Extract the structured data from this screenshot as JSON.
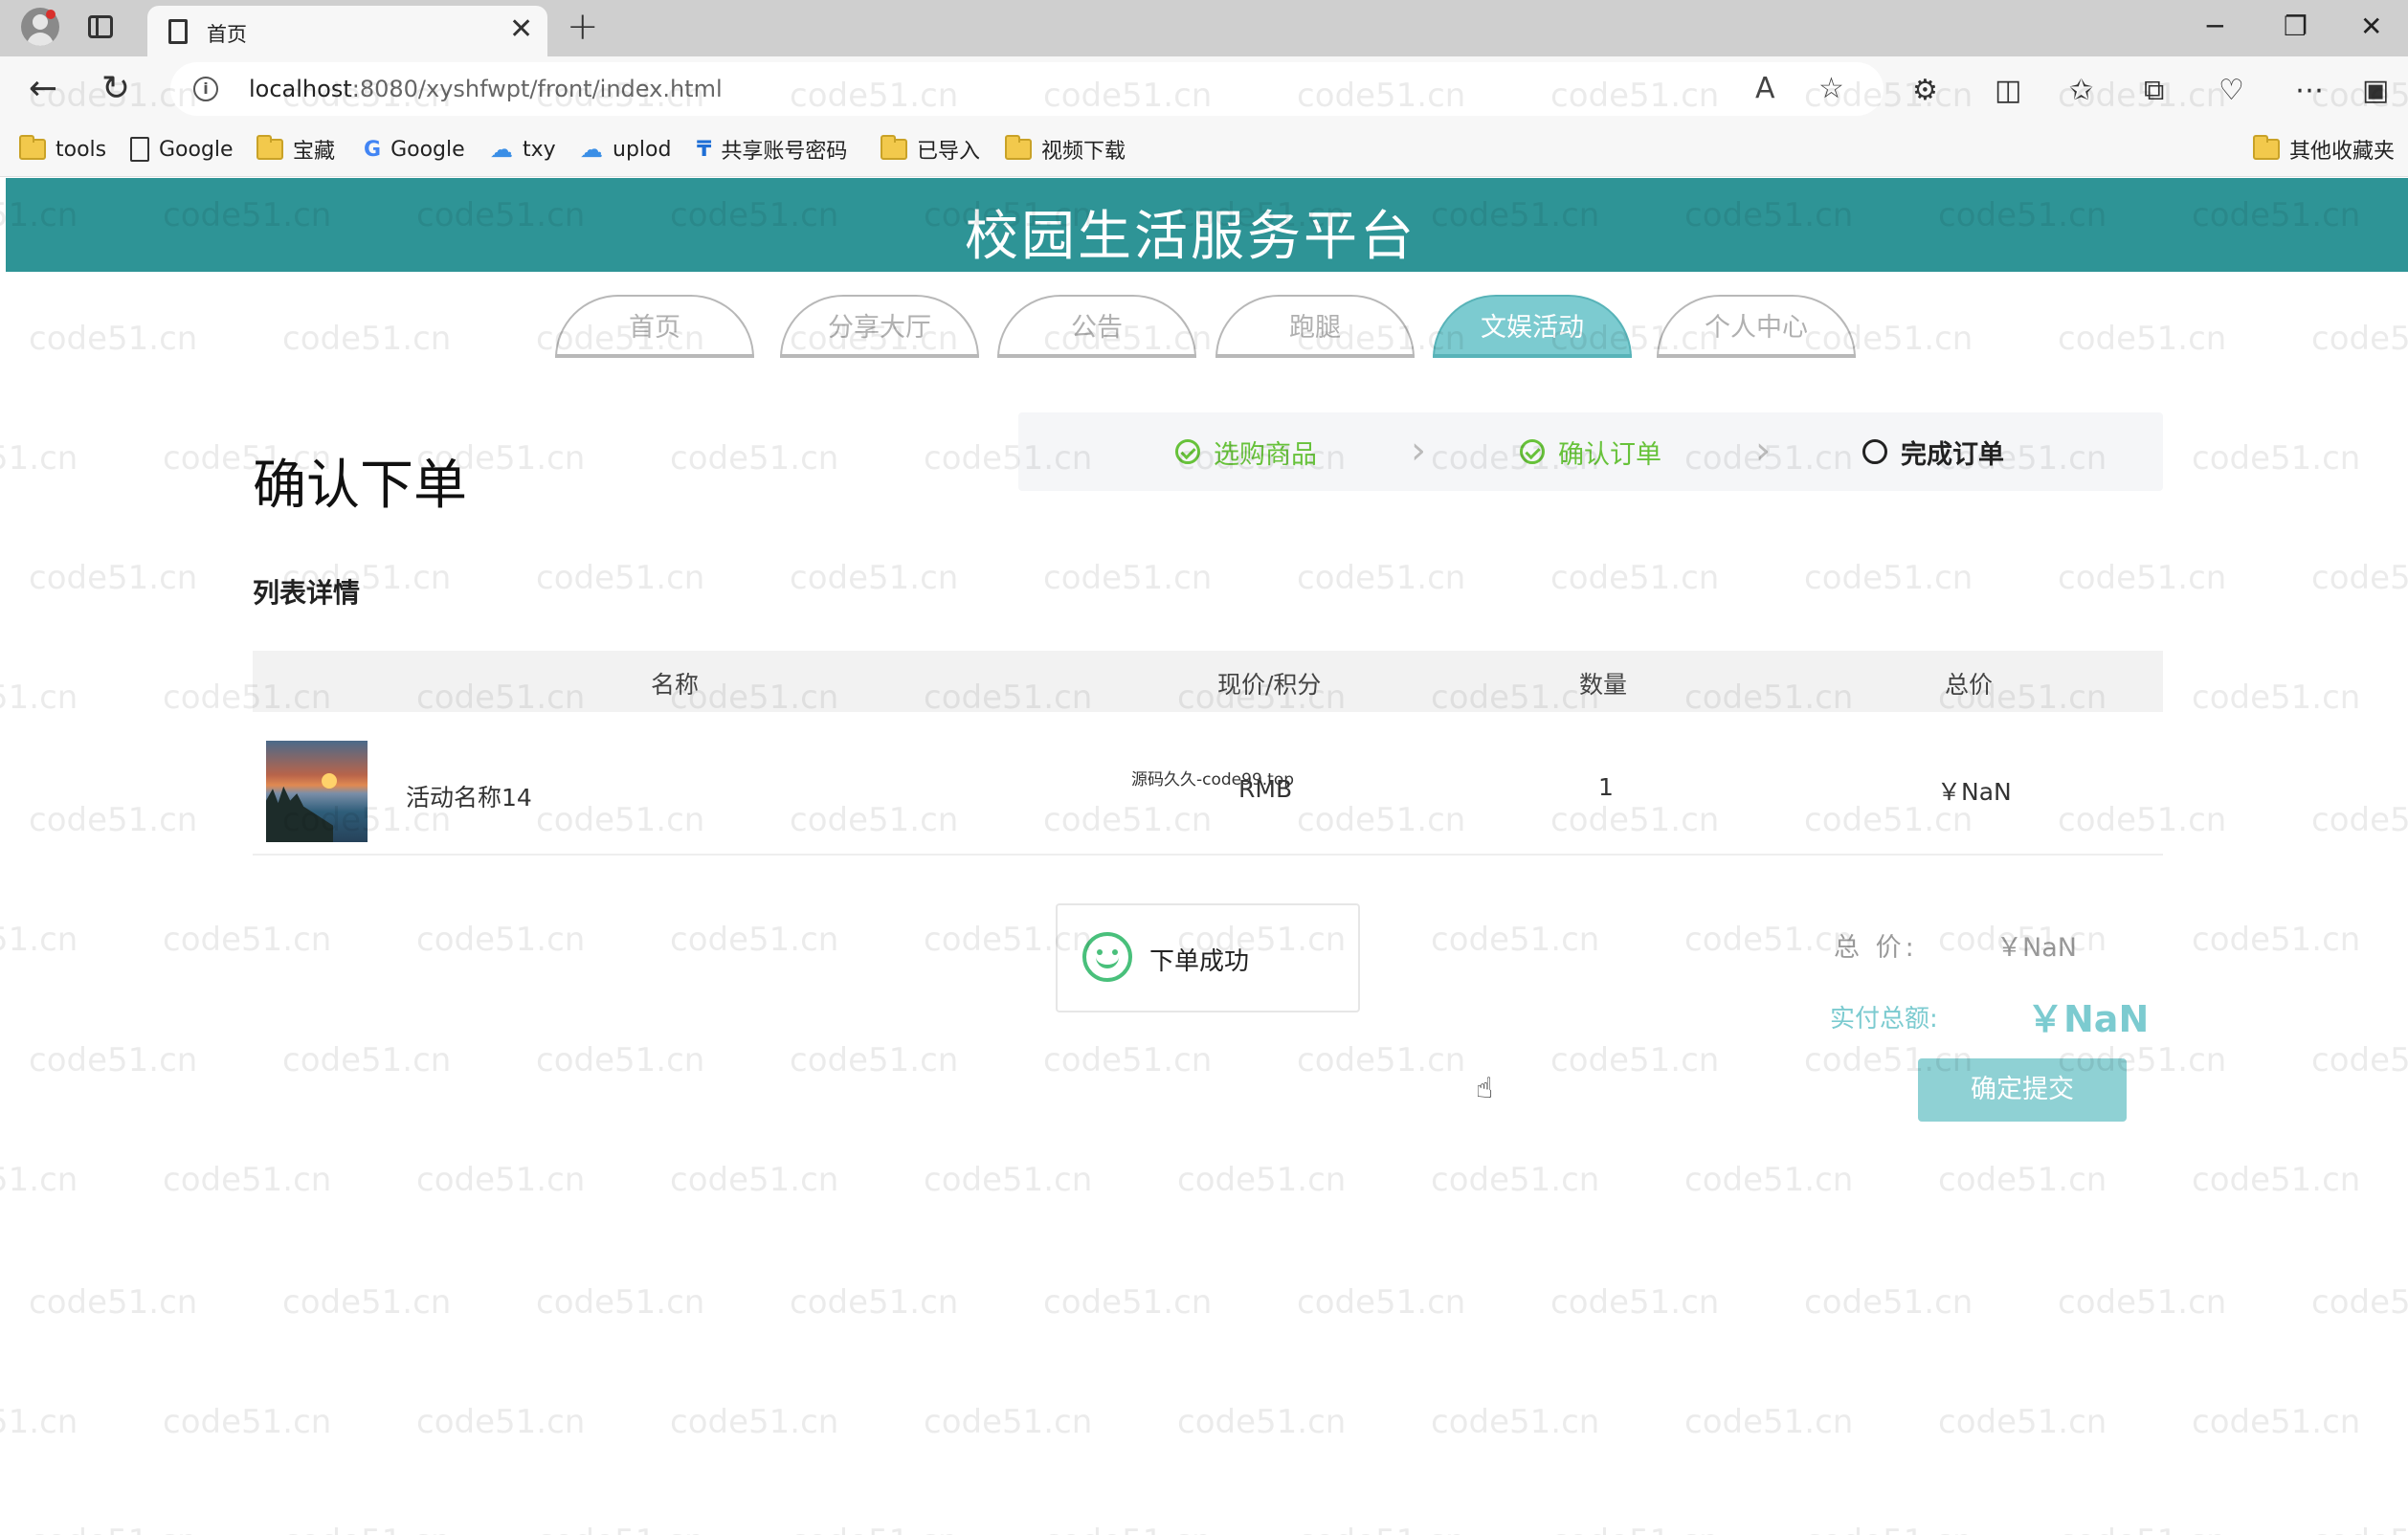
{
  "browser": {
    "tab_title": "首页",
    "url_host": "localhost",
    "url_rest": ":8080/xyshfwpt/front/index.html",
    "bookmarks": [
      {
        "label": "tools",
        "icon": "folder-icon"
      },
      {
        "label": "Google",
        "icon": "page-icon"
      },
      {
        "label": "宝藏",
        "icon": "folder-icon"
      },
      {
        "label": "Google",
        "icon": "google-icon"
      },
      {
        "label": "txy",
        "icon": "cloud-icon"
      },
      {
        "label": "uplod",
        "icon": "cloud-icon"
      },
      {
        "label": "共享账号密码",
        "icon": "app-icon"
      },
      {
        "label": "已导入",
        "icon": "folder-icon"
      },
      {
        "label": "视频下载",
        "icon": "folder-icon"
      }
    ],
    "other_bookmarks": "其他收藏夹"
  },
  "site": {
    "title": "校园生活服务平台",
    "nav": [
      "首页",
      "分享大厅",
      "公告",
      "跑腿",
      "文娱活动",
      "个人中心"
    ],
    "active_nav": "文娱活动"
  },
  "order": {
    "heading": "确认下单",
    "steps": [
      "选购商品",
      "确认订单",
      "完成订单"
    ],
    "list_heading": "列表详情",
    "columns": [
      "名称",
      "现价/积分",
      "数量",
      "总价"
    ],
    "rows": [
      {
        "name": "活动名称14",
        "price_note": "源码久久-code99.top",
        "price": "RMB",
        "quantity": "1",
        "total": "￥NaN"
      }
    ],
    "total_label": "总 价:",
    "total_value": "￥NaN",
    "paid_label": "实付总额:",
    "paid_value": "￥NaN",
    "submit_label": "确定提交"
  },
  "toast": {
    "message": "下单成功"
  },
  "watermark_text": "code51.cn",
  "colors": {
    "header": "#2e9496",
    "accent": "#7ccbd0",
    "success": "#67c23a"
  }
}
